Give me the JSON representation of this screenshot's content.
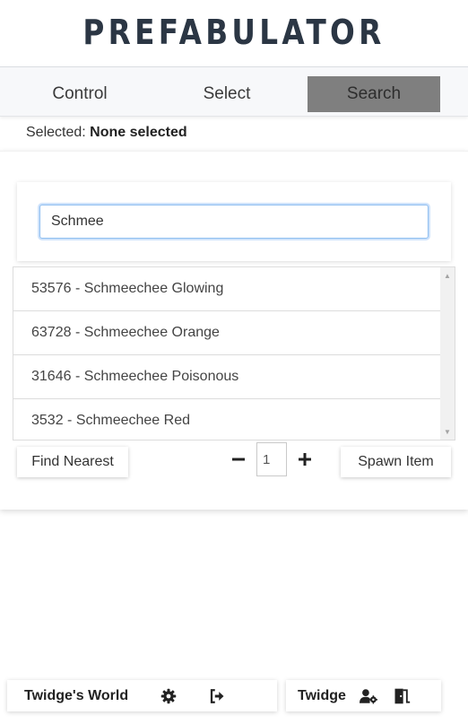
{
  "app": {
    "title": "PREFABULATOR"
  },
  "tabs": [
    {
      "label": "Control",
      "active": false
    },
    {
      "label": "Select",
      "active": false
    },
    {
      "label": "Search",
      "active": true
    }
  ],
  "selection": {
    "prefix": "Selected:",
    "value": "None selected"
  },
  "search": {
    "value": "Schmee",
    "focused": true
  },
  "results": [
    {
      "label": "53576 - Schmeechee Glowing"
    },
    {
      "label": "63728 - Schmeechee Orange"
    },
    {
      "label": "31646 - Schmeechee Poisonous"
    },
    {
      "label": "3532 - Schmeechee Red"
    }
  ],
  "actions": {
    "find_nearest": "Find Nearest",
    "spawn_item": "Spawn Item",
    "quantity": "1",
    "decrement_icon": "minus-icon",
    "increment_icon": "plus-icon"
  },
  "footer": {
    "world_name": "Twidge's World",
    "world_icons": [
      "gear-icon",
      "sign-out-icon"
    ],
    "user_name": "Twidge",
    "user_icons": [
      "user-cog-icon",
      "door-exit-icon"
    ]
  },
  "colors": {
    "title": "#2b3644",
    "active_tab_bg": "#7f7f7f",
    "focus_border": "#8dbdf0"
  }
}
